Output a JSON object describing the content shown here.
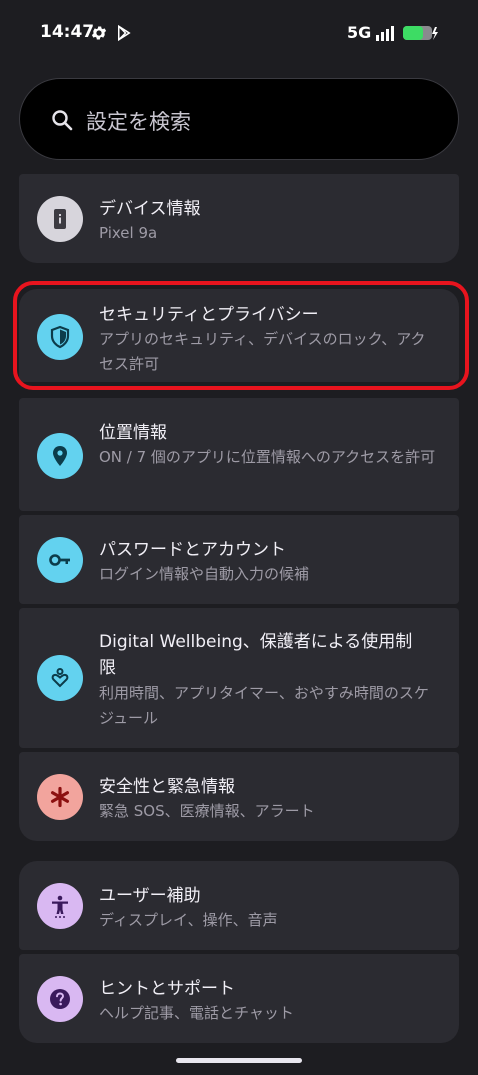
{
  "status_bar": {
    "time": "14:47",
    "network": "5G",
    "icons": [
      "gear-icon",
      "play-store-icon",
      "signal-icon",
      "battery-charging-icon"
    ]
  },
  "search": {
    "placeholder": "設定を検索",
    "icon": "search-icon"
  },
  "items": [
    {
      "title": "デバイス情報",
      "subtitle": "Pixel 9a",
      "icon": "phone-info-icon",
      "icon_bg": "#d7d5dc"
    },
    {
      "title": "セキュリティとプライバシー",
      "subtitle": "アプリのセキュリティ、デバイスのロック、アクセス許可",
      "icon": "shield-icon",
      "icon_bg": "#63d2ef",
      "highlighted": true
    },
    {
      "title": "位置情報",
      "subtitle": "ON / 7 個のアプリに位置情報へのアクセスを許可",
      "icon": "location-pin-icon",
      "icon_bg": "#63d2ef"
    },
    {
      "title": "パスワードとアカウント",
      "subtitle": "ログイン情報や自動入力の候補",
      "icon": "key-icon",
      "icon_bg": "#63d2ef"
    },
    {
      "title": "Digital Wellbeing、保護者による使用制限",
      "subtitle": "利用時間、アプリタイマー、おやすみ時間のスケジュール",
      "icon": "wellbeing-heart-icon",
      "icon_bg": "#63d2ef"
    },
    {
      "title": "安全性と緊急情報",
      "subtitle": "緊急 SOS、医療情報、アラート",
      "icon": "asterisk-icon",
      "icon_bg": "#f2a49d"
    },
    {
      "title": "ユーザー補助",
      "subtitle": "ディスプレイ、操作、音声",
      "icon": "accessibility-icon",
      "icon_bg": "#d9b8f2"
    },
    {
      "title": "ヒントとサポート",
      "subtitle": "ヘルプ記事、電話とチャット",
      "icon": "help-icon",
      "icon_bg": "#d9b8f2"
    }
  ],
  "colors": {
    "background": "#1d1d21",
    "card": "#2b2b31",
    "highlight_border": "#e8141e"
  }
}
